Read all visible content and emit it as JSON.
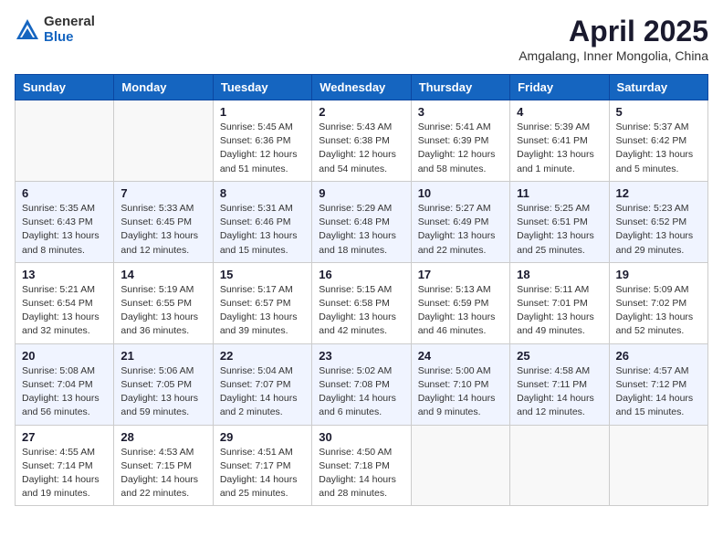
{
  "header": {
    "logo_general": "General",
    "logo_blue": "Blue",
    "month": "April 2025",
    "location": "Amgalang, Inner Mongolia, China"
  },
  "weekdays": [
    "Sunday",
    "Monday",
    "Tuesday",
    "Wednesday",
    "Thursday",
    "Friday",
    "Saturday"
  ],
  "weeks": [
    [
      {
        "day": "",
        "info": ""
      },
      {
        "day": "",
        "info": ""
      },
      {
        "day": "1",
        "info": "Sunrise: 5:45 AM\nSunset: 6:36 PM\nDaylight: 12 hours\nand 51 minutes."
      },
      {
        "day": "2",
        "info": "Sunrise: 5:43 AM\nSunset: 6:38 PM\nDaylight: 12 hours\nand 54 minutes."
      },
      {
        "day": "3",
        "info": "Sunrise: 5:41 AM\nSunset: 6:39 PM\nDaylight: 12 hours\nand 58 minutes."
      },
      {
        "day": "4",
        "info": "Sunrise: 5:39 AM\nSunset: 6:41 PM\nDaylight: 13 hours\nand 1 minute."
      },
      {
        "day": "5",
        "info": "Sunrise: 5:37 AM\nSunset: 6:42 PM\nDaylight: 13 hours\nand 5 minutes."
      }
    ],
    [
      {
        "day": "6",
        "info": "Sunrise: 5:35 AM\nSunset: 6:43 PM\nDaylight: 13 hours\nand 8 minutes."
      },
      {
        "day": "7",
        "info": "Sunrise: 5:33 AM\nSunset: 6:45 PM\nDaylight: 13 hours\nand 12 minutes."
      },
      {
        "day": "8",
        "info": "Sunrise: 5:31 AM\nSunset: 6:46 PM\nDaylight: 13 hours\nand 15 minutes."
      },
      {
        "day": "9",
        "info": "Sunrise: 5:29 AM\nSunset: 6:48 PM\nDaylight: 13 hours\nand 18 minutes."
      },
      {
        "day": "10",
        "info": "Sunrise: 5:27 AM\nSunset: 6:49 PM\nDaylight: 13 hours\nand 22 minutes."
      },
      {
        "day": "11",
        "info": "Sunrise: 5:25 AM\nSunset: 6:51 PM\nDaylight: 13 hours\nand 25 minutes."
      },
      {
        "day": "12",
        "info": "Sunrise: 5:23 AM\nSunset: 6:52 PM\nDaylight: 13 hours\nand 29 minutes."
      }
    ],
    [
      {
        "day": "13",
        "info": "Sunrise: 5:21 AM\nSunset: 6:54 PM\nDaylight: 13 hours\nand 32 minutes."
      },
      {
        "day": "14",
        "info": "Sunrise: 5:19 AM\nSunset: 6:55 PM\nDaylight: 13 hours\nand 36 minutes."
      },
      {
        "day": "15",
        "info": "Sunrise: 5:17 AM\nSunset: 6:57 PM\nDaylight: 13 hours\nand 39 minutes."
      },
      {
        "day": "16",
        "info": "Sunrise: 5:15 AM\nSunset: 6:58 PM\nDaylight: 13 hours\nand 42 minutes."
      },
      {
        "day": "17",
        "info": "Sunrise: 5:13 AM\nSunset: 6:59 PM\nDaylight: 13 hours\nand 46 minutes."
      },
      {
        "day": "18",
        "info": "Sunrise: 5:11 AM\nSunset: 7:01 PM\nDaylight: 13 hours\nand 49 minutes."
      },
      {
        "day": "19",
        "info": "Sunrise: 5:09 AM\nSunset: 7:02 PM\nDaylight: 13 hours\nand 52 minutes."
      }
    ],
    [
      {
        "day": "20",
        "info": "Sunrise: 5:08 AM\nSunset: 7:04 PM\nDaylight: 13 hours\nand 56 minutes."
      },
      {
        "day": "21",
        "info": "Sunrise: 5:06 AM\nSunset: 7:05 PM\nDaylight: 13 hours\nand 59 minutes."
      },
      {
        "day": "22",
        "info": "Sunrise: 5:04 AM\nSunset: 7:07 PM\nDaylight: 14 hours\nand 2 minutes."
      },
      {
        "day": "23",
        "info": "Sunrise: 5:02 AM\nSunset: 7:08 PM\nDaylight: 14 hours\nand 6 minutes."
      },
      {
        "day": "24",
        "info": "Sunrise: 5:00 AM\nSunset: 7:10 PM\nDaylight: 14 hours\nand 9 minutes."
      },
      {
        "day": "25",
        "info": "Sunrise: 4:58 AM\nSunset: 7:11 PM\nDaylight: 14 hours\nand 12 minutes."
      },
      {
        "day": "26",
        "info": "Sunrise: 4:57 AM\nSunset: 7:12 PM\nDaylight: 14 hours\nand 15 minutes."
      }
    ],
    [
      {
        "day": "27",
        "info": "Sunrise: 4:55 AM\nSunset: 7:14 PM\nDaylight: 14 hours\nand 19 minutes."
      },
      {
        "day": "28",
        "info": "Sunrise: 4:53 AM\nSunset: 7:15 PM\nDaylight: 14 hours\nand 22 minutes."
      },
      {
        "day": "29",
        "info": "Sunrise: 4:51 AM\nSunset: 7:17 PM\nDaylight: 14 hours\nand 25 minutes."
      },
      {
        "day": "30",
        "info": "Sunrise: 4:50 AM\nSunset: 7:18 PM\nDaylight: 14 hours\nand 28 minutes."
      },
      {
        "day": "",
        "info": ""
      },
      {
        "day": "",
        "info": ""
      },
      {
        "day": "",
        "info": ""
      }
    ]
  ]
}
